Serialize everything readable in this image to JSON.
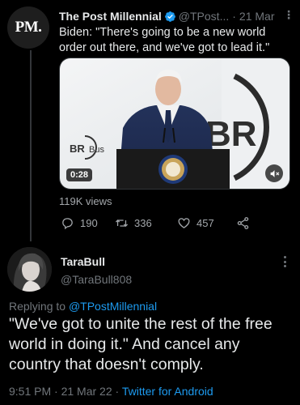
{
  "parent_tweet": {
    "author_name": "The Post Millennial",
    "avatar_text": "PM.",
    "handle": "@TPost...",
    "separator": "·",
    "date": "21 Mar",
    "text": "Biden: \"There's going to be a new world order out there, and we've got to lead it.\"",
    "video": {
      "duration": "0:28",
      "sign_small_text": "BR",
      "sign_small_sub": "Bus",
      "sign_big_text": "BR"
    },
    "views": "119K views",
    "reply_count": "190",
    "retweet_count": "336",
    "like_count": "457"
  },
  "reply_tweet": {
    "author_name": "TaraBull",
    "handle": "@TaraBull808",
    "replying_to_prefix": "Replying to ",
    "replying_to_handle": "@TPostMillennial",
    "text": "\"We've got to unite the rest of the free world in doing it.\" And cancel any country that doesn't comply.",
    "time": "9:51 PM",
    "date": "21 Mar 22",
    "source": "Twitter for Android"
  },
  "colors": {
    "background": "#000000",
    "text_primary": "#e7e9ea",
    "text_secondary": "#71767b",
    "link": "#1d9bf0",
    "verified": "#1d9bf0"
  },
  "icons": [
    "verified-badge-icon",
    "more-icon",
    "mute-icon",
    "reply-icon",
    "retweet-icon",
    "like-icon",
    "share-icon"
  ]
}
